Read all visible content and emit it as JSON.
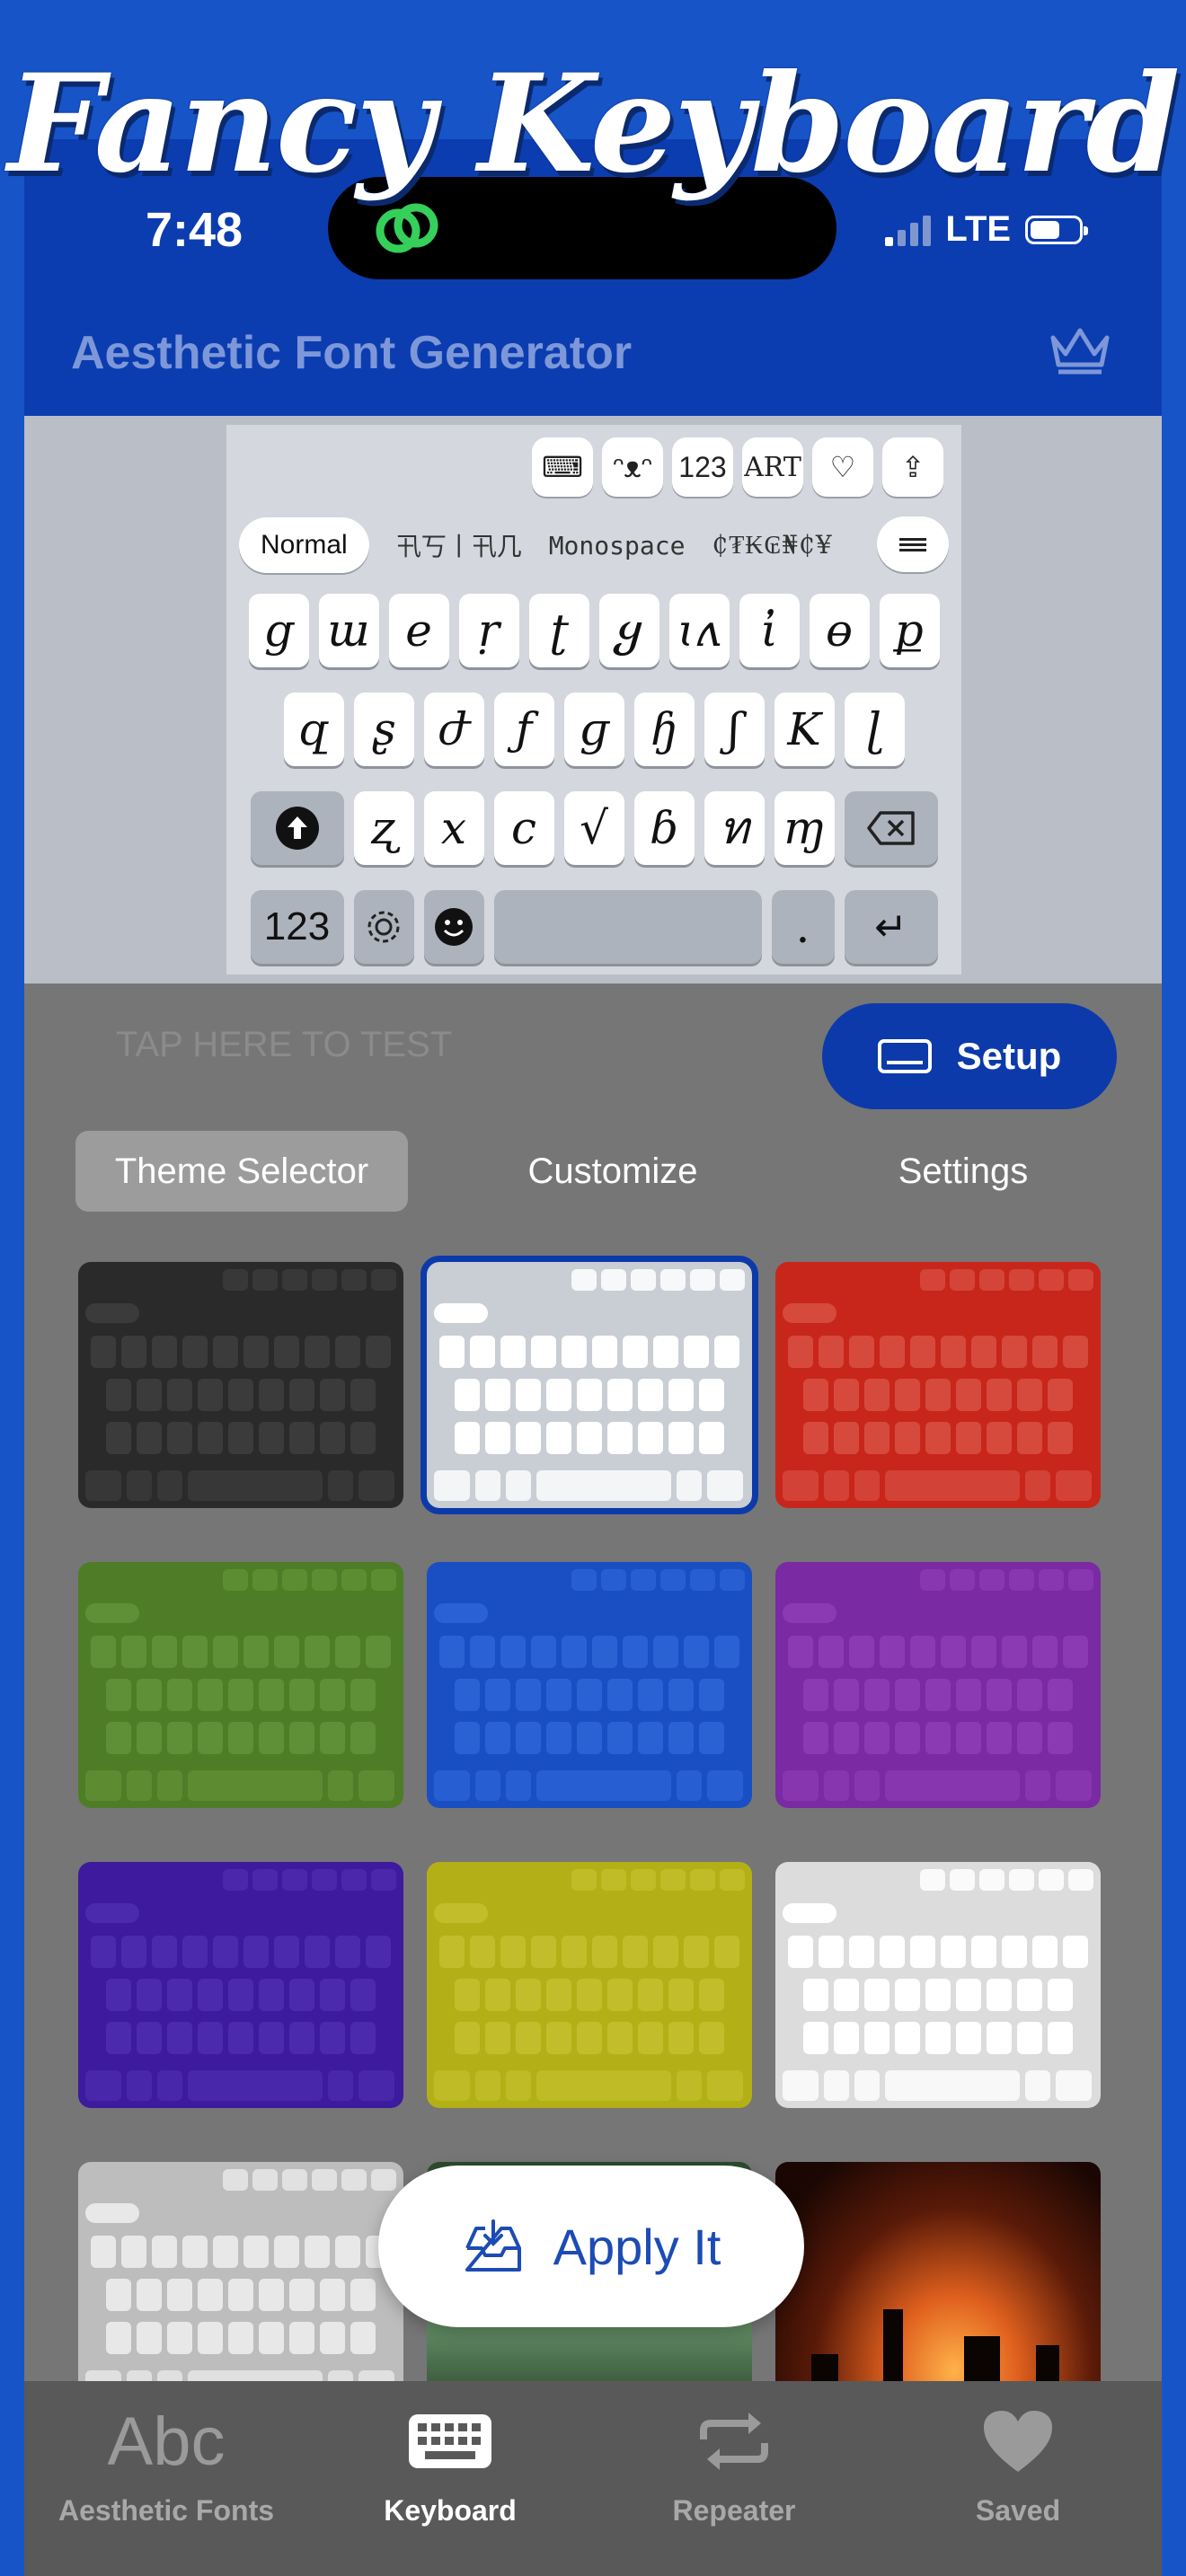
{
  "promo_title": "Fancy Keyboard",
  "status_bar": {
    "time": "7:48",
    "network": "LTE"
  },
  "header": {
    "title": "Aesthetic Font Generator"
  },
  "keyboard_preview": {
    "toolbar": [
      "⌨",
      "ᵔᴥᵔ",
      "123",
      "ART",
      "♡",
      "⇪"
    ],
    "font_options": [
      "Normal",
      "卂丂丨卂几",
      "Monospace",
      "₵₮₭₢₦₵¥"
    ],
    "rows": [
      [
        "ց",
        "ա",
        "e",
        "ṛ",
        "ʈ",
        "ყ",
        "ɩʌ",
        "ἰ",
        "ɵ",
        "ք"
      ],
      [
        "զ",
        "ʂ",
        "ժ",
        "ƒ",
        "ɡ",
        "ɧ",
        "ʃ",
        "K",
        "ɭ"
      ],
      [
        "ʐ",
        "x",
        "c",
        "√",
        "ɓ",
        "ท",
        "ɱ"
      ]
    ],
    "bottom": {
      "num": "123",
      "dot": ".",
      "return": "↵"
    }
  },
  "test_input": {
    "placeholder": "TAP HERE TO TEST"
  },
  "setup_button": {
    "label": "Setup"
  },
  "tabs": [
    {
      "label": "Theme Selector",
      "active": true
    },
    {
      "label": "Customize",
      "active": false
    },
    {
      "label": "Settings",
      "active": false
    }
  ],
  "themes": [
    {
      "name": "black",
      "bg": "#2a2a2a",
      "key": "#3b3b3b"
    },
    {
      "name": "light",
      "bg": "#c9cdd4",
      "key": "#ffffff",
      "selected": true
    },
    {
      "name": "red",
      "bg": "#c8261b",
      "key": "#d64a3e"
    },
    {
      "name": "green",
      "bg": "#4f7d27",
      "key": "#5f8f36"
    },
    {
      "name": "blue",
      "bg": "#1a4fc4",
      "key": "#2a62d4"
    },
    {
      "name": "purple",
      "bg": "#7a2aa2",
      "key": "#8b3ab3"
    },
    {
      "name": "indigo",
      "bg": "#3d1a9e",
      "key": "#4c2aad"
    },
    {
      "name": "olive",
      "bg": "#b3b017",
      "key": "#c2be2b"
    },
    {
      "name": "white-red",
      "bg": "#dcdcdc",
      "key": "#ffffff"
    },
    {
      "name": "gray",
      "bg": "#bdbdbd",
      "key": "#e8e8e8"
    },
    {
      "name": "forest-photo",
      "bg": "#3b5e3c",
      "key": "#5a7d5b"
    },
    {
      "name": "fire-photo",
      "bg": "#4a1808",
      "key": "#6a2a10"
    }
  ],
  "apply_button": {
    "label": "Apply It"
  },
  "tabbar": [
    {
      "label": "Aesthetic Fonts",
      "icon": "Abc"
    },
    {
      "label": "Keyboard",
      "icon": "keyboard",
      "active": true
    },
    {
      "label": "Repeater",
      "icon": "repeat"
    },
    {
      "label": "Saved",
      "icon": "heart"
    }
  ]
}
